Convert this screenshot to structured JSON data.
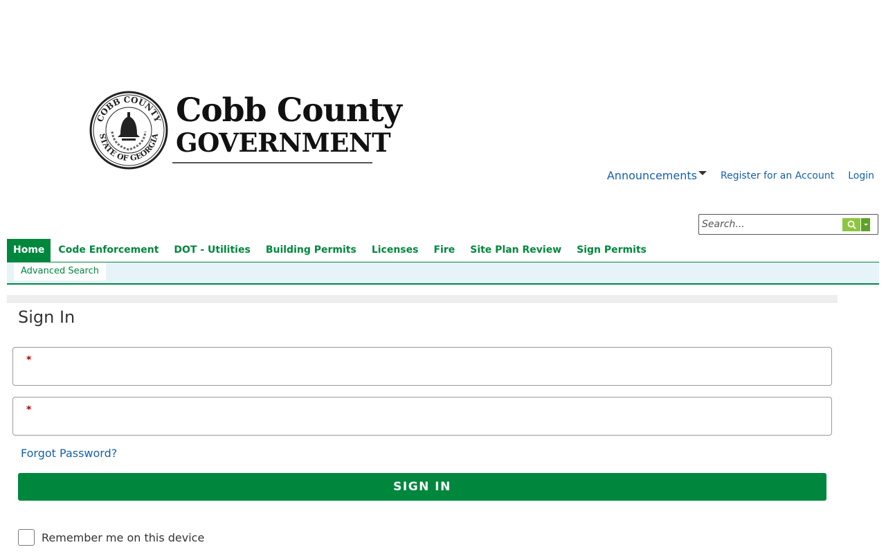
{
  "logo": {
    "title": "Cobb County",
    "subtitle": "GOVERNMENT",
    "seal_top_text": "COBB COUNTY",
    "seal_bottom_text": "STATE OF GEORGIA"
  },
  "top_links": {
    "announcements": "Announcements",
    "register": "Register for an Account",
    "login": "Login"
  },
  "search": {
    "placeholder": "Search..."
  },
  "nav": {
    "tabs": [
      {
        "label": "Home",
        "active": true
      },
      {
        "label": "Code Enforcement"
      },
      {
        "label": "DOT - Utilities"
      },
      {
        "label": "Building Permits"
      },
      {
        "label": "Licenses"
      },
      {
        "label": "Fire"
      },
      {
        "label": "Site Plan Review"
      },
      {
        "label": "Sign Permits"
      }
    ],
    "subnav": {
      "advanced_search": "Advanced Search"
    }
  },
  "signin": {
    "title": "Sign In",
    "field1_required_mark": "*",
    "field2_required_mark": "*",
    "forgot_password": "Forgot Password?",
    "button_label": "SIGN IN",
    "remember_label": "Remember me on this device"
  },
  "colors": {
    "brand_green": "#00873e",
    "link_blue": "#1460aa",
    "search_green": "#8cc63f",
    "subnav_bg": "#e6f4f9"
  },
  "icons": {
    "search": "search-icon",
    "dropdown": "chevron-down-icon"
  }
}
